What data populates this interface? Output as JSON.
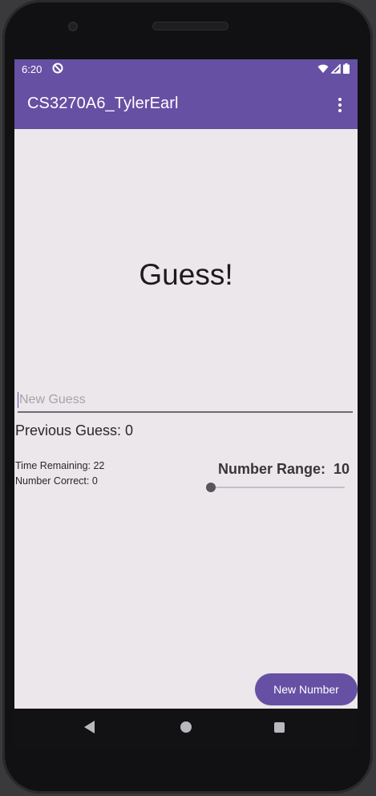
{
  "status_bar": {
    "time": "6:20",
    "icons": [
      "do-not-disturb-icon",
      "wifi-icon",
      "signal-icon",
      "battery-icon"
    ]
  },
  "app_bar": {
    "title": "CS3270A6_TylerEarl",
    "menu_icon": "overflow-menu-icon"
  },
  "main": {
    "heading": "Guess!",
    "guess_input": {
      "value": "",
      "placeholder": "New Guess"
    },
    "previous_guess": "Previous Guess: 0",
    "time_remaining": "Time Remaining: 22",
    "number_correct": "Number Correct: 0",
    "range_label": "Number Range:",
    "range_value": "10",
    "range_slider": {
      "value": 10,
      "min": 10,
      "max": 100,
      "fraction": 0.0
    },
    "new_number_button": "New Number"
  },
  "nav_bar": {
    "icons": [
      "back-icon",
      "home-icon",
      "recents-icon"
    ]
  },
  "colors": {
    "primary": "#6650a4",
    "background": "#ebe7ea",
    "text": "#1c1b1f"
  }
}
